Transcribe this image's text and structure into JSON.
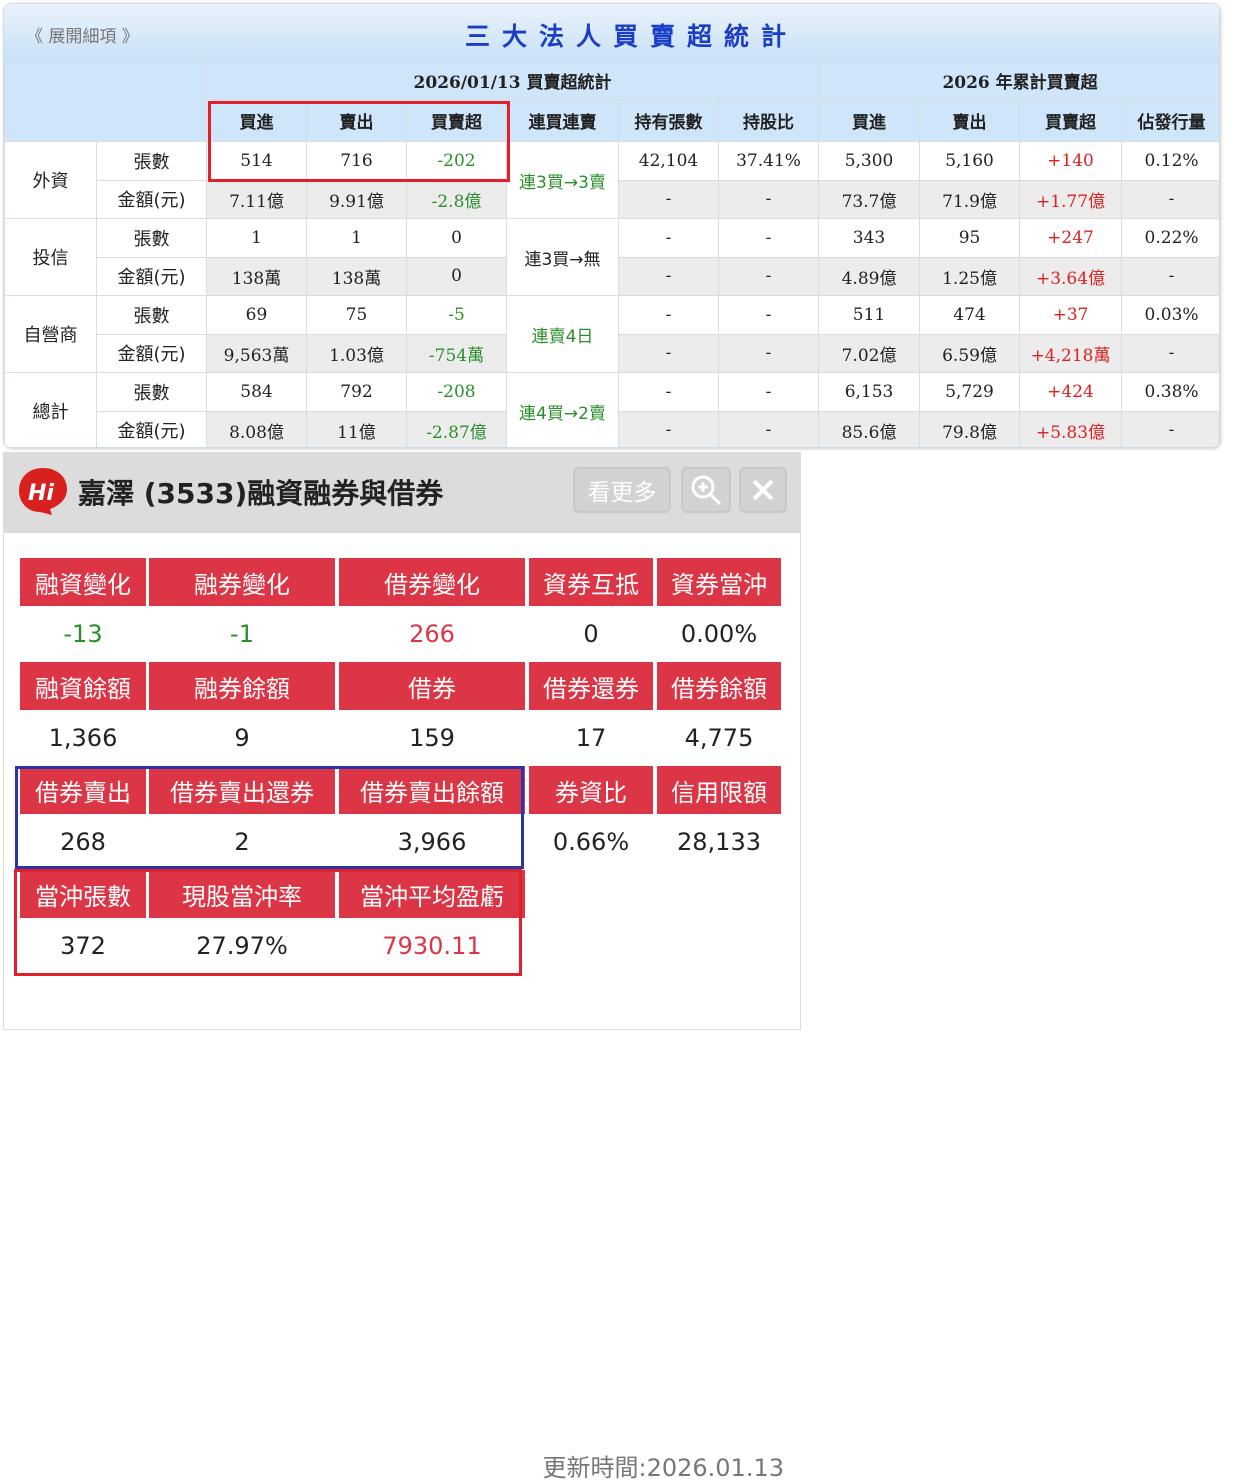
{
  "top": {
    "expand_label": "《 展開細項 》",
    "title": "三大法人買賣超統計",
    "group_daily": "2026/01/13 買賣超統計",
    "group_ytd": "2026 年累計買賣超",
    "columns": [
      "買進",
      "賣出",
      "買賣超",
      "連買連賣",
      "持有張數",
      "持股比",
      "買進",
      "賣出",
      "買賣超",
      "佔發行量"
    ],
    "rows": [
      {
        "name": "外資",
        "streak": "連3買→3賣",
        "streak_color": "green",
        "lots": [
          "514",
          "716",
          "-202",
          "42,104",
          "37.41%",
          "5,300",
          "5,160",
          "+140",
          "0.12%"
        ],
        "amount": [
          "7.11億",
          "9.91億",
          "-2.8億",
          "-",
          "-",
          "73.7億",
          "71.9億",
          "+1.77億",
          "-"
        ]
      },
      {
        "name": "投信",
        "streak": "連3買→無",
        "streak_color": "black",
        "lots": [
          "1",
          "1",
          "0",
          "-",
          "-",
          "343",
          "95",
          "+247",
          "0.22%"
        ],
        "amount": [
          "138萬",
          "138萬",
          "0",
          "-",
          "-",
          "4.89億",
          "1.25億",
          "+3.64億",
          "-"
        ]
      },
      {
        "name": "自營商",
        "streak": "連賣4日",
        "streak_color": "green",
        "lots": [
          "69",
          "75",
          "-5",
          "-",
          "-",
          "511",
          "474",
          "+37",
          "0.03%"
        ],
        "amount": [
          "9,563萬",
          "1.03億",
          "-754萬",
          "-",
          "-",
          "7.02億",
          "6.59億",
          "+4,218萬",
          "-"
        ]
      },
      {
        "name": "總計",
        "streak": "連4買→2賣",
        "streak_color": "green",
        "lots": [
          "584",
          "792",
          "-208",
          "-",
          "-",
          "6,153",
          "5,729",
          "+424",
          "0.38%"
        ],
        "amount": [
          "8.08億",
          "11億",
          "-2.87億",
          "-",
          "-",
          "85.6億",
          "79.8億",
          "+5.83億",
          "-"
        ]
      }
    ],
    "sub_lots": "張數",
    "sub_amount": "金額(元)"
  },
  "panel": {
    "logo_text": "Hi",
    "title": "嘉澤 (3533)融資融券與借券",
    "more_label": "看更多",
    "zoom_icon": "zoom-in-icon",
    "close_icon": "close-icon",
    "grid": [
      [
        {
          "h": "融資變化",
          "v": "-13",
          "c": "green"
        },
        {
          "h": "融券變化",
          "v": "-1",
          "c": "green"
        },
        {
          "h": "借券變化",
          "v": "266",
          "c": "red"
        },
        {
          "h": "資券互抵",
          "v": "0"
        },
        {
          "h": "資券當沖",
          "v": "0.00%"
        }
      ],
      [
        {
          "h": "融資餘額",
          "v": "1,366"
        },
        {
          "h": "融券餘額",
          "v": "9"
        },
        {
          "h": "借券",
          "v": "159"
        },
        {
          "h": "借券還券",
          "v": "17"
        },
        {
          "h": "借券餘額",
          "v": "4,775"
        }
      ],
      [
        {
          "h": "借券賣出",
          "v": "268"
        },
        {
          "h": "借券賣出還券",
          "v": "2"
        },
        {
          "h": "借券賣出餘額",
          "v": "3,966"
        },
        {
          "h": "券資比",
          "v": "0.66%"
        },
        {
          "h": "信用限額",
          "v": "28,133"
        }
      ],
      [
        {
          "h": "當沖張數",
          "v": "372"
        },
        {
          "h": "現股當沖率",
          "v": "27.97%"
        },
        {
          "h": "當沖平均盈虧",
          "v": "7930.11",
          "c": "red"
        }
      ]
    ],
    "update_time": "更新時間:2026.01.13"
  },
  "colors": {
    "red": "#dc3545",
    "green": "#2a8f2a",
    "blue_title": "#1a3ec8"
  }
}
